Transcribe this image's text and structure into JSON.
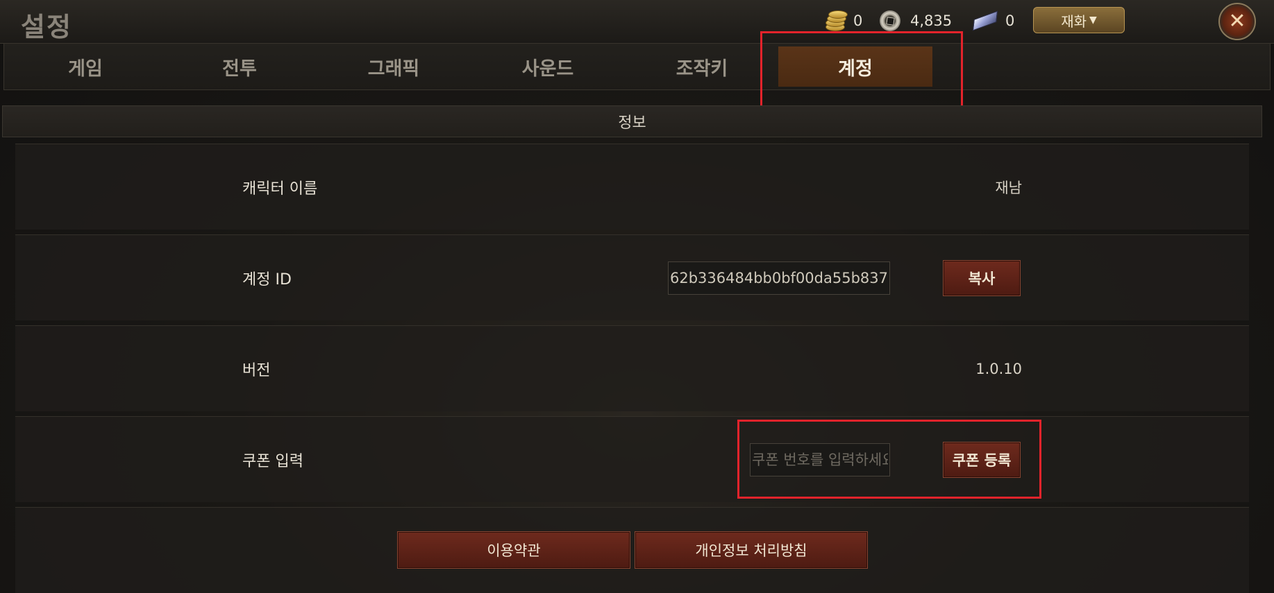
{
  "header": {
    "title": "설정",
    "currencies": [
      {
        "icon": "gold-coins-icon",
        "value": "0"
      },
      {
        "icon": "ring-coin-icon",
        "value": "4,835"
      },
      {
        "icon": "crystal-icon",
        "value": "0"
      }
    ],
    "currency_button": {
      "label": "재화",
      "icon": "triangle-down-icon"
    },
    "close_icon": "close-icon"
  },
  "tabs": [
    {
      "label": "게임",
      "active": false
    },
    {
      "label": "전투",
      "active": false
    },
    {
      "label": "그래픽",
      "active": false
    },
    {
      "label": "사운드",
      "active": false
    },
    {
      "label": "조작키",
      "active": false
    },
    {
      "label": "계정",
      "active": true
    }
  ],
  "section": {
    "title": "정보"
  },
  "rows": {
    "character_name": {
      "label": "캐릭터 이름",
      "value": "재남"
    },
    "account_id": {
      "label": "계정 ID",
      "value": "62b336484bb0bf00da55b837",
      "button": "복사"
    },
    "version": {
      "label": "버전",
      "value": "1.0.10"
    },
    "coupon": {
      "label": "쿠폰 입력",
      "placeholder": "쿠폰 번호를 입력하세요",
      "button": "쿠폰 등록"
    }
  },
  "footer_buttons": {
    "terms": "이용약관",
    "privacy": "개인정보 처리방침"
  },
  "colors": {
    "highlight": "#e3232b",
    "active_tab": "#5a3418",
    "button_red": "#6e2a1d"
  }
}
